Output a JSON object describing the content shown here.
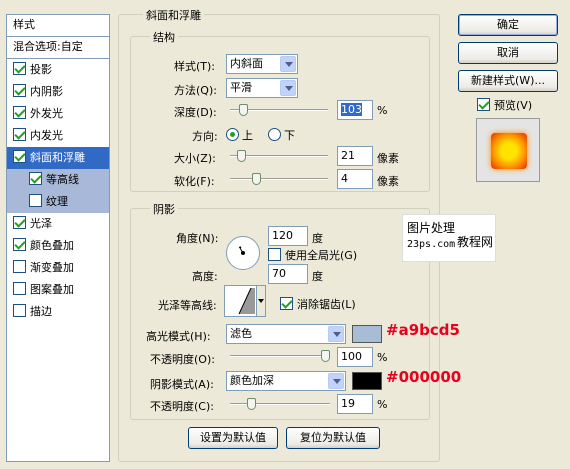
{
  "left_panel": {
    "header": "样式",
    "blend_options": "混合选项:自定",
    "items": [
      {
        "label": "投影",
        "checked": true
      },
      {
        "label": "内阴影",
        "checked": true
      },
      {
        "label": "外发光",
        "checked": true
      },
      {
        "label": "内发光",
        "checked": true
      },
      {
        "label": "斜面和浮雕",
        "checked": true,
        "selected": true
      },
      {
        "label": "等高线",
        "checked": true,
        "sub": true
      },
      {
        "label": "纹理",
        "checked": false,
        "sub": true
      },
      {
        "label": "光泽",
        "checked": true
      },
      {
        "label": "颜色叠加",
        "checked": true
      },
      {
        "label": "渐变叠加",
        "checked": false
      },
      {
        "label": "图案叠加",
        "checked": false
      },
      {
        "label": "描边",
        "checked": false
      }
    ]
  },
  "bevel": {
    "title": "斜面和浮雕",
    "structure": {
      "title": "结构",
      "style_label": "样式(T):",
      "style_value": "内斜面",
      "technique_label": "方法(Q):",
      "technique_value": "平滑",
      "depth_label": "深度(D):",
      "depth_value": "103",
      "depth_unit": "%",
      "depth_slider": 0.1,
      "direction_label": "方向:",
      "dir_up": "上",
      "dir_down": "下",
      "size_label": "大小(Z):",
      "size_value": "21",
      "size_unit": "像素",
      "size_slider": 0.08,
      "soften_label": "软化(F):",
      "soften_value": "4",
      "soften_unit": "像素",
      "soften_slider": 0.25
    },
    "shading": {
      "title": "阴影",
      "angle_label": "角度(N):",
      "angle_value": "120",
      "angle_unit": "度",
      "global_light": "使用全局光(G)",
      "altitude_label": "高度:",
      "altitude_value": "70",
      "altitude_unit": "度",
      "gloss_label": "光泽等高线:",
      "antialias": "消除锯齿(L)",
      "highlight_mode_label": "高光模式(H):",
      "highlight_mode_value": "滤色",
      "highlight_color": "#a9bcd5",
      "highlight_anno": "#a9bcd5",
      "opacity1_label": "不透明度(O):",
      "opacity1_value": "100",
      "opacity1_slider": 1.0,
      "shadow_mode_label": "阴影模式(A):",
      "shadow_mode_value": "颜色加深",
      "shadow_color": "#000000",
      "shadow_anno": "#000000",
      "opacity2_label": "不透明度(C):",
      "opacity2_value": "19",
      "opacity2_slider": 0.19,
      "percent": "%"
    },
    "make_default": "设置为默认值",
    "reset_default": "复位为默认值"
  },
  "buttons": {
    "ok": "确定",
    "cancel": "取消",
    "new_style": "新建样式(W)...",
    "preview": "预览(V)"
  },
  "watermark": {
    "line1": "图片处理",
    "line2": "23ps.com",
    "line3": "教程网"
  }
}
